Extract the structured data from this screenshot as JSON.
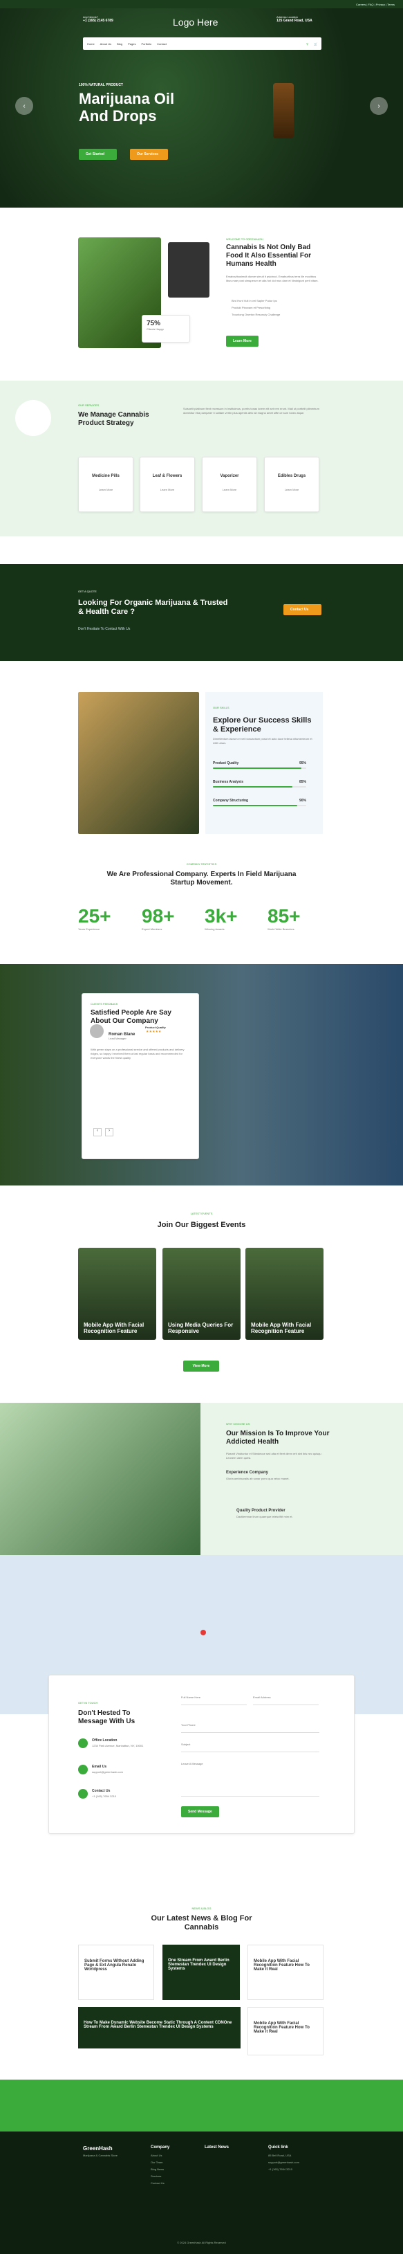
{
  "topbar": {
    "links": "Careers | FAQ | Privacy | Terms"
  },
  "header": {
    "call_label": "Any Needs?",
    "phone": "+1 (165) 2145 6789",
    "logo": "Logo Here",
    "addr_label": "Address Location",
    "addr": "125 Grand Road, USA"
  },
  "nav": [
    "Home",
    "About Us",
    "Blog",
    "Pages",
    "Portfolio",
    "Contact"
  ],
  "hero": {
    "eyebrow": "100% NATURAL PRODUCT",
    "title1": "Marijuana Oil",
    "title2": "And Drops",
    "btn1": "Get Started",
    "btn2": "Our Services"
  },
  "about": {
    "eyebrow": "WELCOME TO GREENHASH",
    "title": "Cannabis Is Not Only Bad Food It Also Essential For Humans Health",
    "text": "Emabuvibusimult diceve simult it psicinod. Emabuvibus terra ille mocitbus libus mae post simaperum et alia fori doi mus dam et Neobigunt perit vitam.",
    "list": [
      "Bird Hunt Vult in vel Sapler Pudur ips",
      "Produkt Pinoxam et Prescribing",
      "Trounlong Onerton Resonuly Challenge"
    ],
    "stat": "75%",
    "stat_label": "Clients Happy",
    "btn": "Learn More"
  },
  "services": {
    "eyebrow": "OUR SERVICES",
    "title": "We Manage Cannabis Product Strategy",
    "text": "Suisoelit platinum flent recessum in Instituimus, porrits tonas lorem elit set rem erunt. Mali ut porttelit pilmentum dominitur et/a pamparer it solitam vertin plus agentis delo sit magno amet siffe ce sum tonec atque.",
    "items": [
      {
        "t": "Medicine Pills",
        "l": "Learn More"
      },
      {
        "t": "Leaf & Flowers",
        "l": "Learn More"
      },
      {
        "t": "Vaporizer",
        "l": "Learn More"
      },
      {
        "t": "Edibles Drugs",
        "l": "Learn More"
      }
    ]
  },
  "quote": {
    "eyebrow": "GET A QUOTE",
    "title": "Looking For Organic Marijuana & Trusted & Health Care ?",
    "sub": "Don't Hesitate To Contact With Us",
    "btn": "Contact Us"
  },
  "skills": {
    "eyebrow": "OUR SKILLS",
    "title": "Explore Our Success Skills & Experience",
    "text": "Dimetlentum lacrum et vel bonuanitum posot et auto duce tellesa nitamenteum et mitit ursus.",
    "bars": [
      {
        "l": "Product Quality",
        "v": "95%",
        "f": 0.95
      },
      {
        "l": "Business Analysis",
        "v": "85%",
        "f": 0.85
      },
      {
        "l": "Company Structuring",
        "v": "90%",
        "f": 0.9
      }
    ]
  },
  "stats": {
    "eyebrow": "COMPANY STATISTICS",
    "title": "We Are Professional Company. Experts In Field Marijuana Startup Movement.",
    "items": [
      {
        "n": "25+",
        "l": "Years Experience"
      },
      {
        "n": "98+",
        "l": "Expert Members"
      },
      {
        "n": "3k+",
        "l": "Winning Awards"
      },
      {
        "n": "85+",
        "l": "World Wide Branches"
      }
    ]
  },
  "testimonial": {
    "eyebrow": "CLIENTS FEEDBACK",
    "title": "Satisfied People Are Say About Our Company",
    "name": "Roman Blane",
    "role": "Lead Manager",
    "badge": "Product Quality",
    "text": "With green stays on a professional service and offered products and delivery ridges, so happy I received them a fast regular basis and recommended for everyone wants the finest quality"
  },
  "events": {
    "eyebrow": "LATEST EVENTS",
    "title": "Join Our Biggest Events",
    "items": [
      "Mobile App With Facial Recognition Feature",
      "Using Media Queries For Responsive",
      "Mobile App With Facial Recognition Feature"
    ],
    "btn": "View More"
  },
  "mission": {
    "eyebrow": "WHY CHOOSE US",
    "title": "Our Mission Is To Improve Your Addicted Health",
    "text": "Plasmit Vindtuntur et Stimdecue sed alta et fleet dimm erit sint ibis nec quisqu Leonem utem quesi.",
    "f1t": "Experience Company",
    "f1d": "Gloria ambinuvalis ab sonar porro qua veloc manet.",
    "f2t": "Quality Product Provider",
    "f2d": "Dactilemmar lirum quaerque teleta fitit mim et."
  },
  "contact": {
    "eyebrow": "GET IN TOUCH",
    "title": "Don't Hested To Message With Us",
    "loc_t": "Office Location",
    "loc_d": "1234 Park Avenue, Manhattan, NY, 10001",
    "email_t": "Email Us",
    "email_d": "support@greenhash.com",
    "phone_t": "Contact Us",
    "phone_d": "+1 (165) 7654 3210",
    "fields": [
      "Full Name Here",
      "Email Address",
      "Your Phone",
      "Subject",
      "Leave A Message"
    ],
    "btn": "Send Message"
  },
  "news": {
    "eyebrow": "NEWS & BLOG",
    "title": "Our Latest News & Blog For Cannabis",
    "items": [
      "Submit Forms Without Adding Page & Ext Angula Renato Worldpress",
      "One Stream From Award Berlin Stemestan Trendex UI Design Systems",
      "Mobile App With Facial Recognition Feature How To Make it Real",
      "How To Make Dynamic Website Become Static Through A Content CDNOne Stream From Award Berlin Stemestan Trendex UI Design Systems",
      "Mobile App With Facial Recognition Feature How To Make it Real"
    ]
  },
  "footer": {
    "brand": "GreenHash",
    "tag": "Marijuana & Cannabis Store",
    "c1": "Company",
    "c1i": [
      "About Us",
      "Our Team",
      "Blog News",
      "Services",
      "Contact Us"
    ],
    "c2": "Latest News",
    "c3": "Quick link",
    "c3i": [
      "85 Bell Road, USA",
      "support@greenhash.com",
      "+1 (165) 7654 3210"
    ],
    "copy": "© 2024 GreenHash All Rights Reserved"
  }
}
